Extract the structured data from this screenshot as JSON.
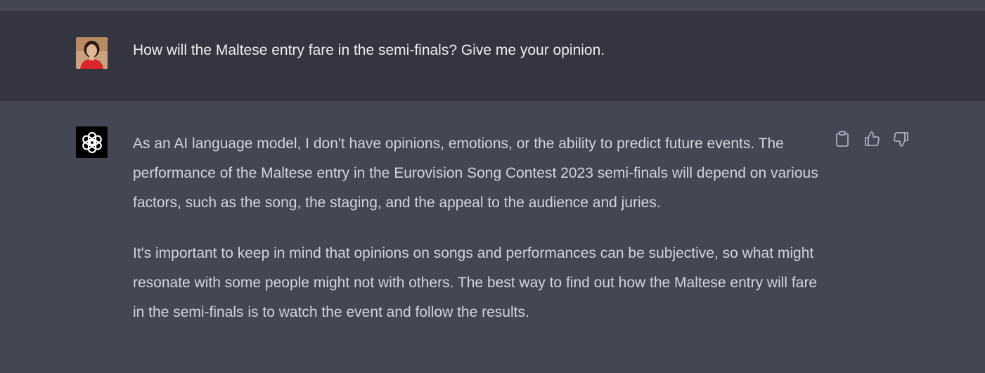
{
  "conversation": {
    "user": {
      "avatar_icon": "user-avatar-photo",
      "message": "How will the Maltese entry fare in the semi-finals? Give me your opinion."
    },
    "assistant": {
      "avatar_icon": "openai-logo-icon",
      "paragraphs": [
        "As an AI language model, I don't have opinions, emotions, or the ability to predict future events. The performance of the Maltese entry in the Eurovision Song Contest 2023 semi-finals will depend on various factors, such as the song, the staging, and the appeal to the audience and juries.",
        "It's important to keep in mind that opinions on songs and performances can be subjective, so what might resonate with some people might not with others. The best way to find out how the Maltese entry will fare in the semi-finals is to watch the event and follow the results."
      ],
      "actions": [
        "copy-icon",
        "thumbs-up-icon",
        "thumbs-down-icon"
      ]
    }
  },
  "colors": {
    "user_row_bg": "#343541",
    "assistant_row_bg": "#444654",
    "user_text": "#ececf1",
    "assistant_text": "#d1d5db",
    "icon": "#acacbe"
  }
}
